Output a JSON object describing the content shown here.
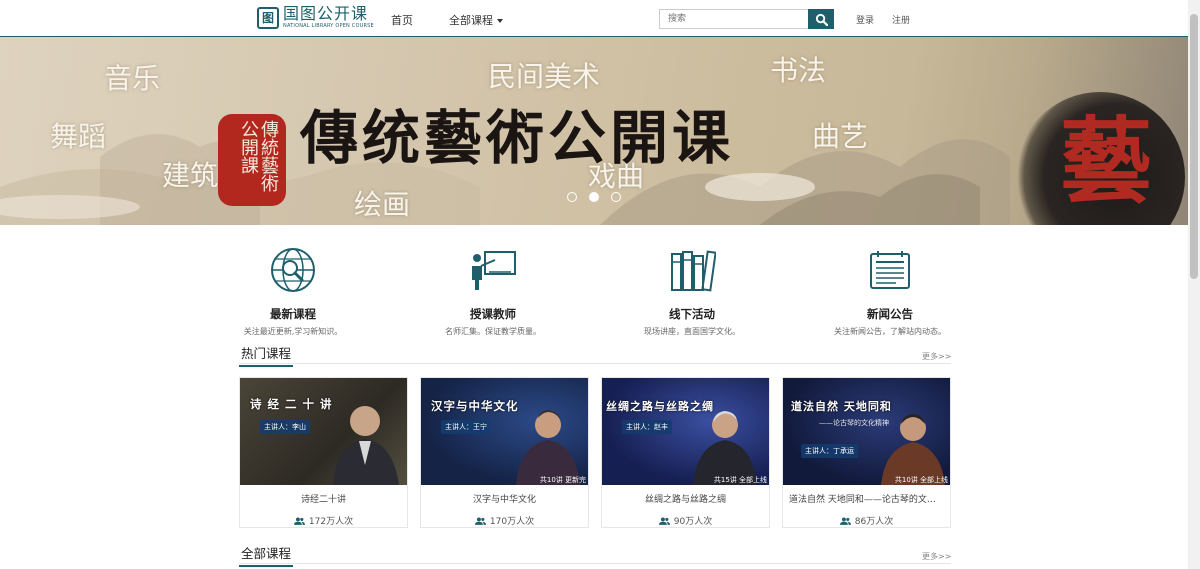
{
  "header": {
    "logo_mark": "图",
    "logo_cn": "国图公开课",
    "logo_en": "NATIONAL LIBRARY OPEN COURSE",
    "nav_home": "首页",
    "nav_all": "全部课程",
    "search_placeholder": "搜索",
    "login": "登录",
    "register": "注册"
  },
  "banner": {
    "title": "傳统藝術公開课",
    "seal": "傳統藝術公開課",
    "ink_char": "藝",
    "words": [
      "音乐",
      "民间美术",
      "书法",
      "舞蹈",
      "曲艺",
      "建筑",
      "戏曲",
      "绘画"
    ],
    "active_slide": 2,
    "slide_count": 3
  },
  "features": [
    {
      "icon": "globe-search-icon",
      "title": "最新课程",
      "desc": "关注最近更新,学习新知识。"
    },
    {
      "icon": "teacher-board-icon",
      "title": "授课教师",
      "desc": "名师汇集。保证教学质量。"
    },
    {
      "icon": "books-icon",
      "title": "线下活动",
      "desc": "现场讲座，直面国学文化。"
    },
    {
      "icon": "newspaper-icon",
      "title": "新闻公告",
      "desc": "关注新闻公告，了解站内动态。"
    }
  ],
  "hot": {
    "title": "热门课程",
    "more": "更多>>",
    "cards": [
      {
        "thumb_title": "诗 经 二 十 讲",
        "thumb_host": "主讲人：李山",
        "thumb_sub": "",
        "badge": "",
        "title": "诗经二十讲",
        "views": "172万人次",
        "bg": "#3b3a33"
      },
      {
        "thumb_title": "汉字与中华文化",
        "thumb_host": "主讲人：王宁",
        "thumb_sub": "",
        "badge": "共10讲  更新完",
        "title": "汉字与中华文化",
        "views": "170万人次",
        "bg": "#1c2c4e"
      },
      {
        "thumb_title": "丝绸之路与丝路之绸",
        "thumb_host": "主讲人：赵丰",
        "thumb_sub": "",
        "badge": "共15讲  全部上线",
        "title": "丝绸之路与丝路之绸",
        "views": "90万人次",
        "bg": "#1b2a5a"
      },
      {
        "thumb_title": "道法自然  天地同和",
        "thumb_host": "主讲人：丁承运",
        "thumb_sub": "——论古琴的文化精神",
        "badge": "共10讲  全部上线",
        "title": "道法自然 天地同和——论古琴的文化...",
        "views": "86万人次",
        "bg": "#1a2344"
      }
    ]
  },
  "all": {
    "title": "全部课程",
    "more": "更多>>"
  },
  "colors": {
    "accent": "#1f5f6b",
    "seal_red": "#b3281e"
  }
}
